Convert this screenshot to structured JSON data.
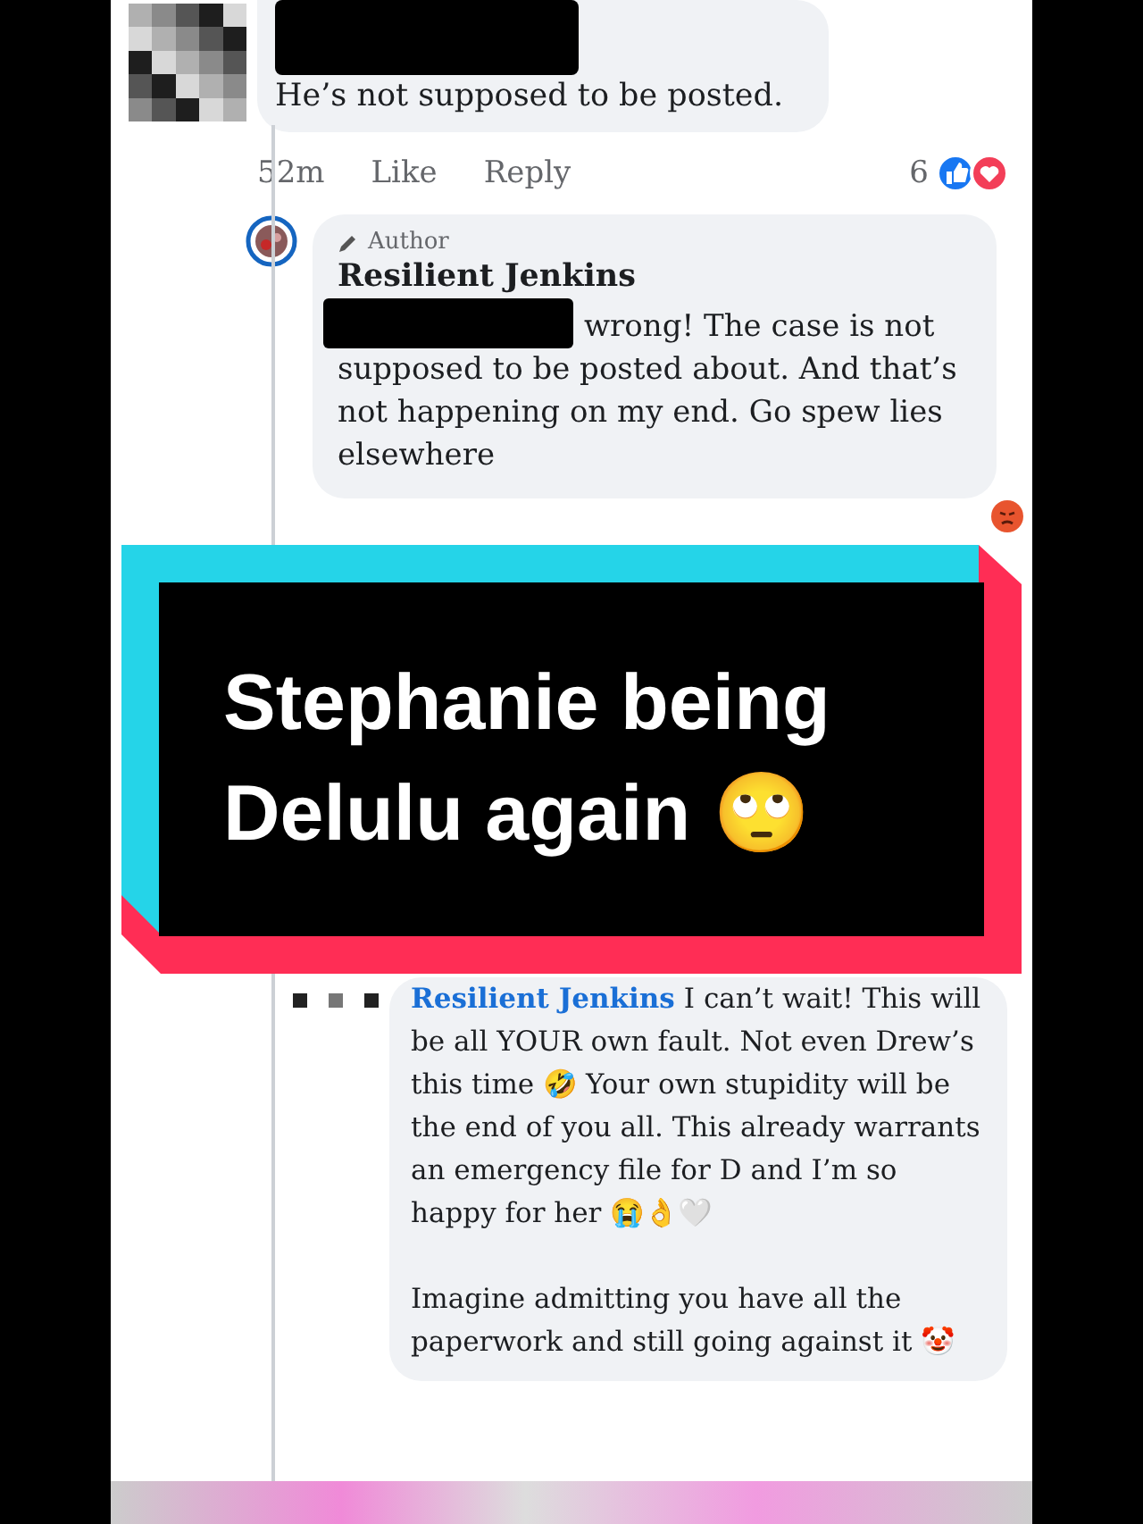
{
  "comments": [
    {
      "kind": "comment",
      "name_redacted": true,
      "paragraphs": [
        "He’s not supposed to be posted."
      ],
      "time": "52m",
      "like": "Like",
      "reply": "Reply",
      "reaction_count": "6"
    },
    {
      "kind": "reply",
      "author_badge": "Author",
      "name": "Resilient Jenkins",
      "lead_redacted": true,
      "lead_text": "wrong! The case is not",
      "paragraphs": [
        "supposed to be posted about. And that’s not happening on my end. Go spew lies elsewhere"
      ]
    },
    {
      "kind": "reply_mention",
      "mention": "Resilient Jenkins",
      "paragraphs": [
        "I can’t wait! This will be all YOUR own fault. Not even Drew’s this time 🤣 Your own stupidity will be the end of you all. This already warrants an emergency file for D and I’m so happy for her 😭👌🤍",
        "Imagine admitting you have all the paperwork and still going against it 🤡"
      ]
    }
  ],
  "overlay": {
    "caption": "Stephanie being Delulu again 🙄"
  }
}
